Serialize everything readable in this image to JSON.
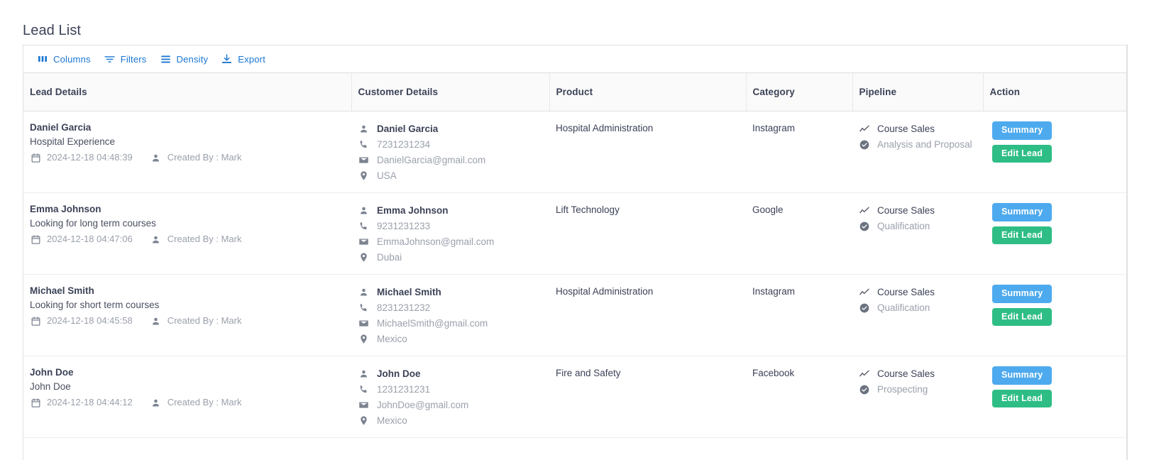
{
  "page": {
    "title": "Lead List"
  },
  "toolbar": {
    "columns_label": "Columns",
    "filters_label": "Filters",
    "density_label": "Density",
    "export_label": "Export"
  },
  "table": {
    "headers": {
      "lead_details": "Lead Details",
      "customer_details": "Customer Details",
      "product": "Product",
      "category": "Category",
      "pipeline": "Pipeline",
      "action": "Action"
    },
    "action_labels": {
      "summary": "Summary",
      "edit_lead": "Edit Lead"
    },
    "rows": [
      {
        "lead_name": "Daniel Garcia",
        "lead_sub": "Hospital Experience",
        "created_at": "2024-12-18 04:48:39",
        "created_by": "Created By : Mark",
        "customer_name": "Daniel Garcia",
        "phone": "7231231234",
        "email": "DanielGarcia@gmail.com",
        "location": "USA",
        "product": "Hospital Administration",
        "category": "Instagram",
        "pipeline_stage": "Course Sales",
        "pipeline_status": "Analysis and Proposal"
      },
      {
        "lead_name": "Emma Johnson",
        "lead_sub": "Looking for long term courses",
        "created_at": "2024-12-18 04:47:06",
        "created_by": "Created By : Mark",
        "customer_name": "Emma Johnson",
        "phone": "9231231233",
        "email": "EmmaJohnson@gmail.com",
        "location": "Dubai",
        "product": "Lift Technology",
        "category": "Google",
        "pipeline_stage": "Course Sales",
        "pipeline_status": "Qualification"
      },
      {
        "lead_name": "Michael Smith",
        "lead_sub": "Looking for short term courses",
        "created_at": "2024-12-18 04:45:58",
        "created_by": "Created By : Mark",
        "customer_name": "Michael Smith",
        "phone": "8231231232",
        "email": "MichaelSmith@gmail.com",
        "location": "Mexico",
        "product": "Hospital Administration",
        "category": "Instagram",
        "pipeline_stage": "Course Sales",
        "pipeline_status": "Qualification"
      },
      {
        "lead_name": "John Doe",
        "lead_sub": "John Doe",
        "created_at": "2024-12-18 04:44:12",
        "created_by": "Created By : Mark",
        "customer_name": "John Doe",
        "phone": "1231231231",
        "email": "JohnDoe@gmail.com",
        "location": "Mexico",
        "product": "Fire and Safety",
        "category": "Facebook",
        "pipeline_stage": "Course Sales",
        "pipeline_status": "Prospecting"
      }
    ]
  },
  "icons": {
    "columns": "columns-icon",
    "filters": "filter-icon",
    "density": "density-icon",
    "export": "export-icon",
    "calendar": "calendar-icon",
    "person": "person-icon",
    "phone": "phone-icon",
    "mail": "mail-icon",
    "location": "location-pin-icon",
    "trending": "trending-up-icon",
    "check": "check-circle-icon"
  },
  "colors": {
    "toolbar_link": "#1976d2",
    "summary_button": "#4eaaee",
    "edit_button": "#2ebd85",
    "header_bg": "#fafafa",
    "alt_row_bg": "#fafafa",
    "text_primary": "#3c4257",
    "text_muted": "#9aa0ab"
  }
}
